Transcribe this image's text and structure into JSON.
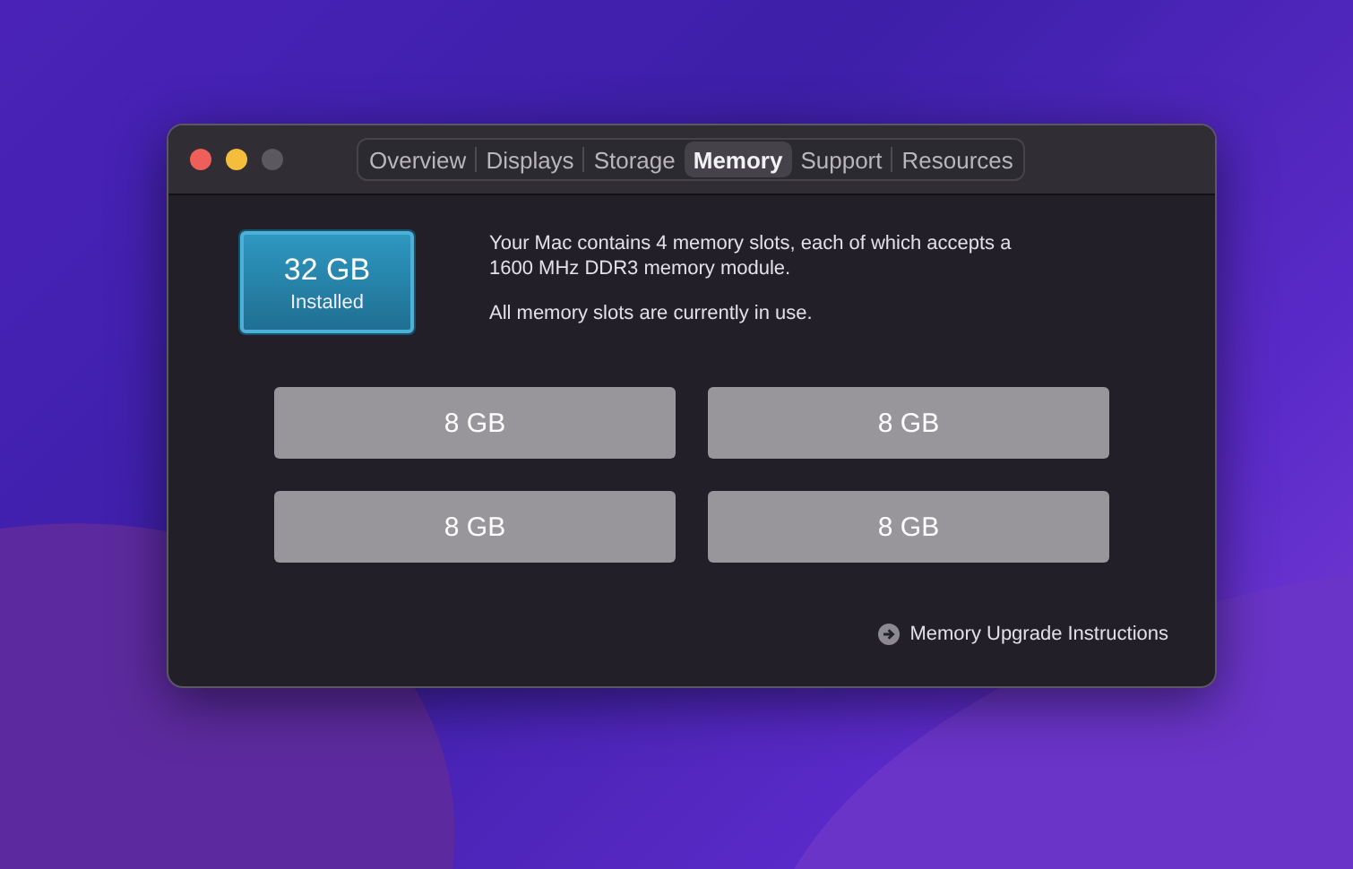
{
  "window": {
    "tabs": [
      {
        "label": "Overview",
        "selected": false
      },
      {
        "label": "Displays",
        "selected": false
      },
      {
        "label": "Storage",
        "selected": false
      },
      {
        "label": "Memory",
        "selected": true
      },
      {
        "label": "Support",
        "selected": false
      },
      {
        "label": "Resources",
        "selected": false
      }
    ]
  },
  "memory": {
    "total": "32 GB",
    "total_label": "Installed",
    "description": [
      "Your Mac contains 4 memory slots, each of which accepts a 1600 MHz DDR3 memory module.",
      "All memory slots are currently in use."
    ],
    "slots": [
      "8 GB",
      "8 GB",
      "8 GB",
      "8 GB"
    ],
    "link": "Memory Upgrade Instructions"
  }
}
